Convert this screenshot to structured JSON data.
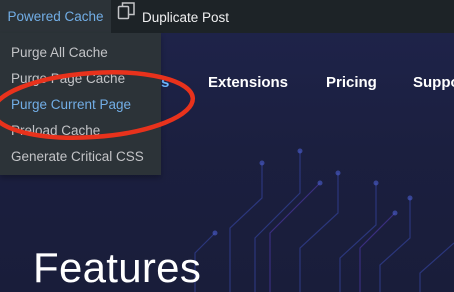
{
  "admin_bar": {
    "powered_cache_label": "Powered Cache",
    "duplicate_post_label": "Duplicate Post",
    "duplicate_icon": "duplicate-icon"
  },
  "dropdown": {
    "items": [
      {
        "label": "Purge All Cache",
        "active": false
      },
      {
        "label": "Purge Page Cache",
        "active": false
      },
      {
        "label": "Purge Current Page",
        "active": true
      },
      {
        "label": "Preload Cache",
        "active": false
      },
      {
        "label": "Generate Critical CSS",
        "active": false
      }
    ]
  },
  "site_nav": {
    "partial_item": "s",
    "items": [
      "Extensions",
      "Pricing",
      "Suppo"
    ]
  },
  "hero": {
    "heading": "Features"
  },
  "colors": {
    "admin_bar_bg": "#1d2327",
    "dropdown_bg": "#2c3338",
    "link_blue": "#72aee6",
    "page_bg": "#1b1f3e",
    "annotation_red": "#e8321c"
  }
}
